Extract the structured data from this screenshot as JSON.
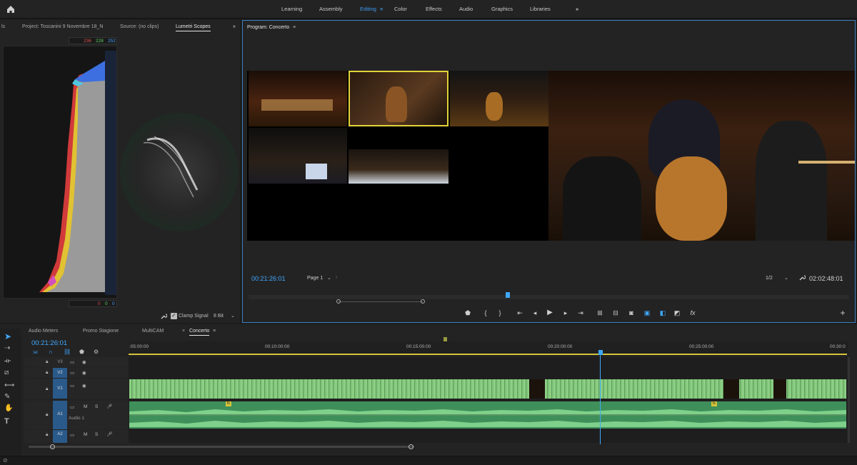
{
  "workspace_tabs": [
    "Learning",
    "Assembly",
    "Editing",
    "Color",
    "Effects",
    "Audio",
    "Graphics",
    "Libraries"
  ],
  "active_workspace": "Editing",
  "left_panel": {
    "tabs": [
      "ls",
      "Project: Toscanini 9 Novembre 18_N",
      "Source: (no clips)",
      "Lumetri Scopes"
    ],
    "active_tab": "Lumetri Scopes",
    "scope_readout_top": [
      "236",
      "228",
      "252"
    ],
    "scope_readout_bottom": [
      "0",
      "0",
      "0"
    ],
    "clamp_signal_label": "Clamp Signal",
    "clamp_signal_checked": true,
    "bit_depth": "8 Bit"
  },
  "program_monitor": {
    "title": "Program: Concerto",
    "timecode_current": "00:21:26:01",
    "page_label": "Page 1",
    "resolution": "1/2",
    "timecode_duration": "02:02:48:01"
  },
  "timeline": {
    "tabs": [
      "Audio Meters",
      "Promo Stagione",
      "MultiCAM",
      "Concerto"
    ],
    "active_tab": "Concerto",
    "timecode": "00:21:26:01",
    "ruler_labels": [
      ":05:00:00",
      "00:10:00:00",
      "00:15:00:00",
      "00:20:00:00",
      "00:25:00:00",
      "00:30:0"
    ],
    "video_tracks": [
      "V3",
      "V2",
      "V1"
    ],
    "audio_tracks": [
      "A1",
      "A2"
    ],
    "audio_track_name": "Audio 1",
    "playhead_fraction": 0.655
  },
  "colors": {
    "accent": "#3d9bf0",
    "video_clip": "#7fc27a",
    "audio_clip": "#3f8f5a",
    "timeline_yellow": "#d4c43a"
  }
}
